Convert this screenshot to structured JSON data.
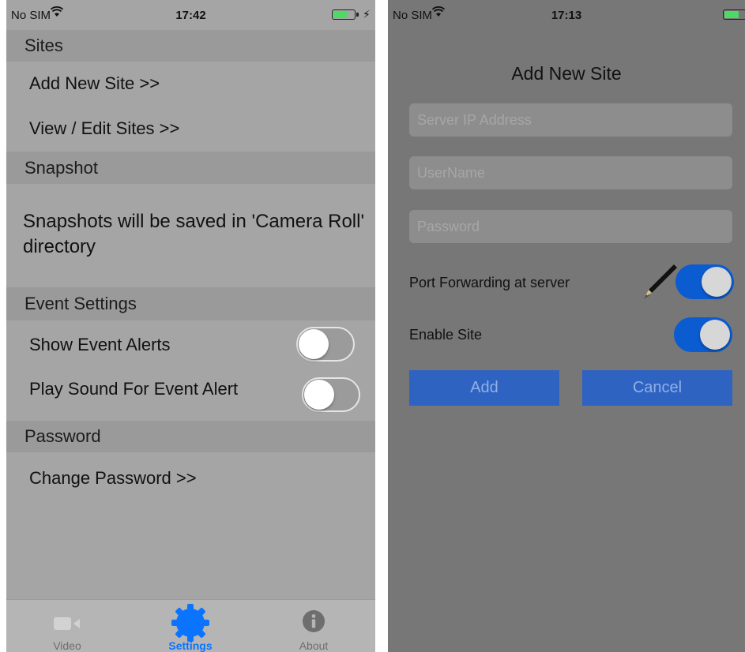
{
  "left_screen": {
    "status_bar": {
      "carrier": "No SIM",
      "time": "17:42"
    },
    "sections": {
      "sites": {
        "header": "Sites",
        "add_new_site": "Add New Site >>",
        "view_edit_sites": "View / Edit Sites >>"
      },
      "snapshot": {
        "header": "Snapshot",
        "note": "Snapshots will be saved in 'Camera Roll' directory"
      },
      "event_settings": {
        "header": "Event Settings",
        "show_event_alerts": {
          "label": "Show Event Alerts",
          "enabled": false
        },
        "play_sound": {
          "label": "Play Sound For Event Alert",
          "enabled": false
        }
      },
      "password": {
        "header": "Password",
        "change_password": "Change Password >>"
      }
    },
    "tab_bar": {
      "tabs": [
        {
          "label": "Video",
          "icon": "video-camera-icon",
          "active": false
        },
        {
          "label": "Settings",
          "icon": "gear-icon",
          "active": true
        },
        {
          "label": "About",
          "icon": "info-icon",
          "active": false
        }
      ]
    }
  },
  "right_screen": {
    "status_bar": {
      "carrier": "No SIM",
      "time": "17:13"
    },
    "dialog": {
      "title": "Add New Site",
      "server_ip_placeholder": "Server IP Address",
      "username_placeholder": "UserName",
      "password_placeholder": "Password",
      "port_forwarding": {
        "label": "Port Forwarding at server",
        "enabled": true
      },
      "enable_site": {
        "label": "Enable Site",
        "enabled": true
      },
      "add_label": "Add",
      "cancel_label": "Cancel"
    }
  },
  "colors": {
    "accent": "#0a74ff",
    "toggle_on": "#0b5bd1",
    "button_bg": "#2f63c2",
    "battery": "#4cd964"
  }
}
